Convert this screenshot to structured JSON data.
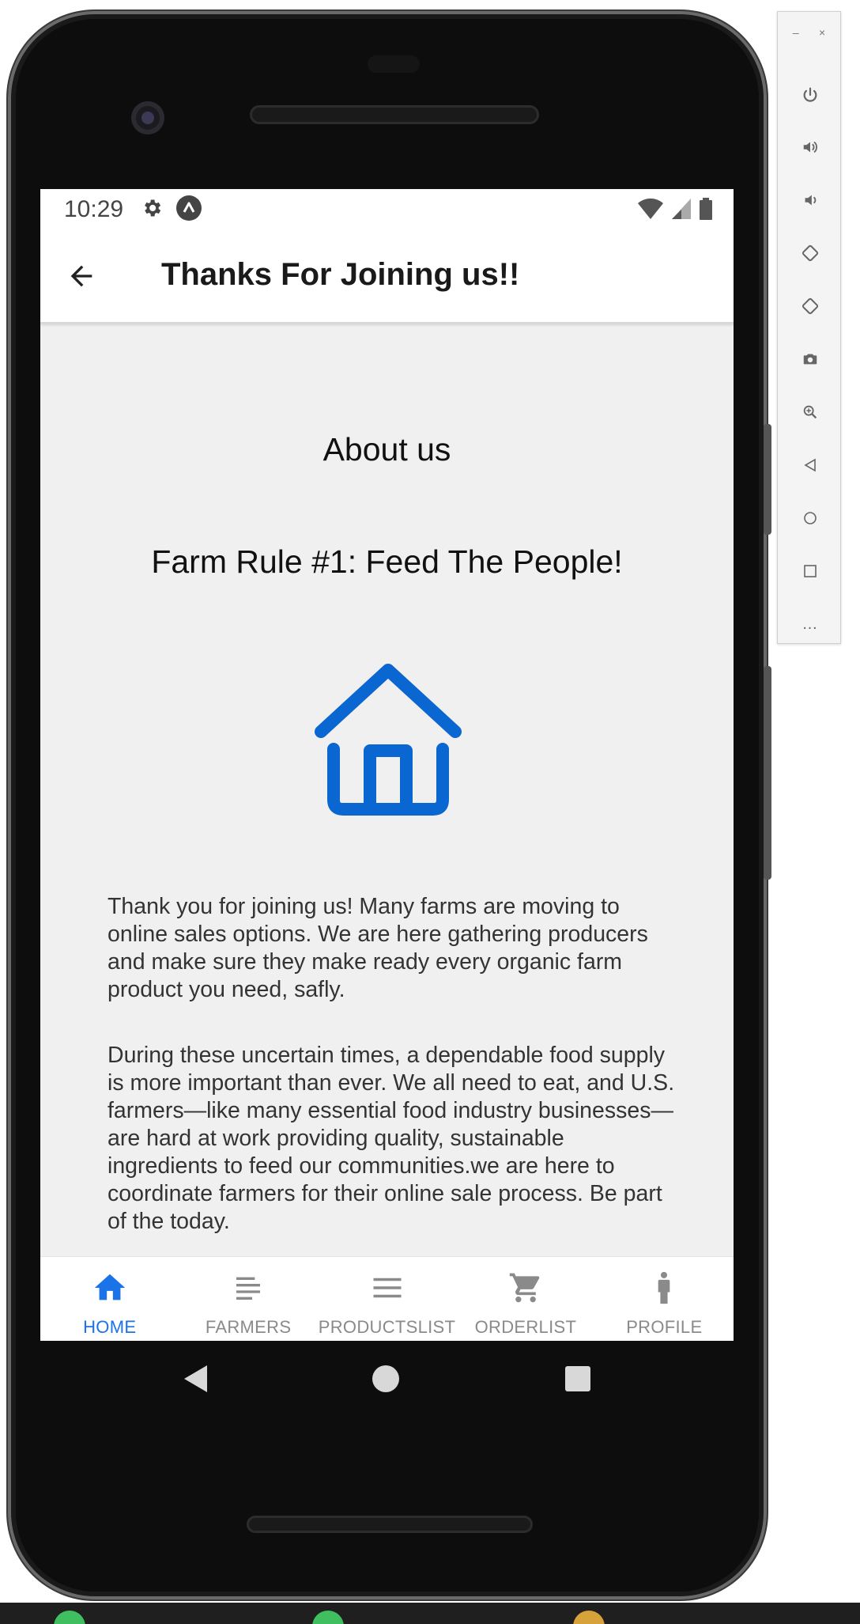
{
  "status_bar": {
    "time": "10:29"
  },
  "app_bar": {
    "title": "Thanks For Joining us!!"
  },
  "content": {
    "about_title": "About us",
    "rule_title": "Farm Rule #1: Feed The People!",
    "paragraph_1": "Thank you for joining us! Many farms are moving to online sales options. We are here gathering producers and make sure they make ready every organic farm product you need, safly.",
    "paragraph_2": "During these uncertain times, a dependable food supply is more important than ever. We all need to eat, and U.S. farmers—like many essential food industry businesses—are hard at work providing quality, sustainable ingredients to feed our communities.we are here to coordinate farmers for their online sale process. Be part of the today."
  },
  "bottom_nav": {
    "items": [
      {
        "label": "HOME",
        "icon": "home-icon",
        "active": true
      },
      {
        "label": "FARMERS",
        "icon": "lines-icon",
        "active": false
      },
      {
        "label": "PRODUCTSLIST",
        "icon": "menu-icon",
        "active": false
      },
      {
        "label": "ORDERLIST",
        "icon": "cart-icon",
        "active": false
      },
      {
        "label": "PROFILE",
        "icon": "person-icon",
        "active": false
      }
    ]
  },
  "emulator_toolbar": {
    "minimize": "–",
    "close": "×",
    "more": "…",
    "buttons": [
      "power-icon",
      "volume-up-icon",
      "volume-down-icon",
      "rotate-left-icon",
      "rotate-right-icon",
      "camera-icon",
      "zoom-icon",
      "back-icon",
      "home-icon",
      "overview-icon",
      "more-icon"
    ]
  },
  "colors": {
    "accent": "#1a73e8",
    "icon_blue": "#0a66d0",
    "inactive": "#8a8a8a",
    "screen_bg": "#f0f0f0"
  }
}
